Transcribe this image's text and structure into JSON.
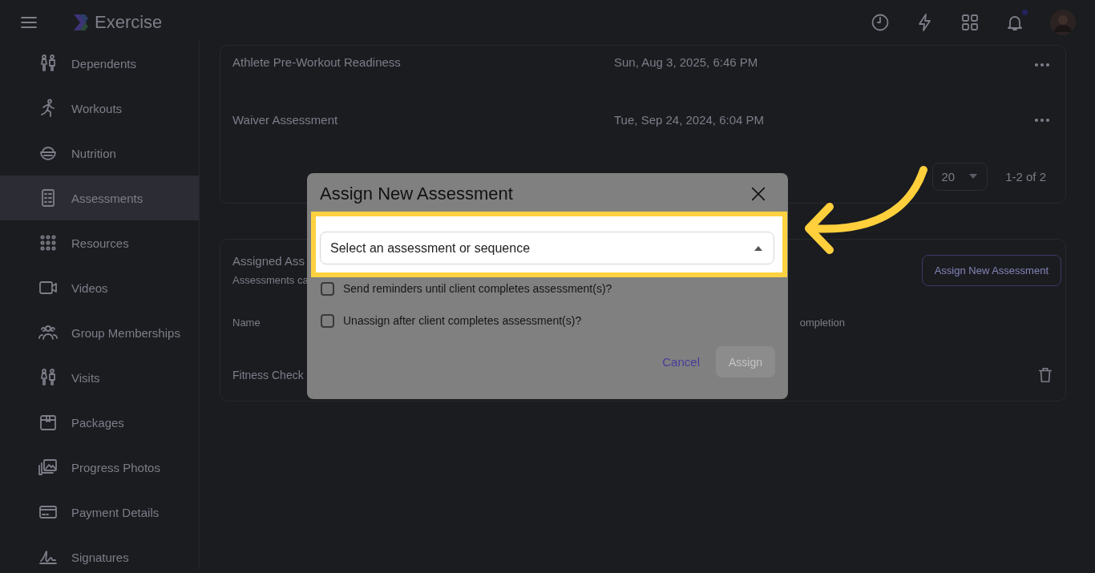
{
  "header": {
    "title": "Exercise",
    "has_notification": true
  },
  "sidebar": {
    "items": [
      {
        "label": "Dependents",
        "kind": "people",
        "selected": false
      },
      {
        "label": "Workouts",
        "kind": "runner",
        "selected": false
      },
      {
        "label": "Nutrition",
        "kind": "bowl",
        "selected": false
      },
      {
        "label": "Assessments",
        "kind": "checklist",
        "selected": true
      },
      {
        "label": "Resources",
        "kind": "dots",
        "selected": false
      },
      {
        "label": "Videos",
        "kind": "camera",
        "selected": false
      },
      {
        "label": "Group Memberships",
        "kind": "group",
        "selected": false
      },
      {
        "label": "Visits",
        "kind": "people",
        "selected": false
      },
      {
        "label": "Packages",
        "kind": "box",
        "selected": false
      },
      {
        "label": "Progress Photos",
        "kind": "photos",
        "selected": false
      },
      {
        "label": "Payment Details",
        "kind": "card",
        "selected": false
      },
      {
        "label": "Signatures",
        "kind": "signature",
        "selected": false
      }
    ]
  },
  "assessments_list": {
    "rows": [
      {
        "name": "Athlete Pre-Workout Readiness",
        "date": "Sun, Aug 3, 2025, 6:46 PM"
      },
      {
        "name": "Waiver Assessment",
        "date": "Tue, Sep 24, 2024, 6:04 PM"
      }
    ],
    "pagination": {
      "page_size": "20",
      "range": "1-2 of 2"
    }
  },
  "assigned": {
    "title": "Assigned Ass",
    "subtitle": "Assessments ca",
    "button": "Assign New Assessment",
    "columns": [
      "Name",
      "ompletion"
    ],
    "rows": [
      {
        "name": "Fitness Check"
      }
    ]
  },
  "dialog": {
    "title": "Assign New Assessment",
    "select": {
      "placeholder": "Select an assessment or sequence",
      "expanded": true
    },
    "options": [
      {
        "label": "Send reminders until client completes assessment(s)?",
        "checked": false
      },
      {
        "label": "Unassign after client completes assessment(s)?",
        "checked": false
      }
    ],
    "buttons": [
      {
        "label": "Cancel",
        "kind": "text",
        "disabled": false
      },
      {
        "label": "Assign",
        "kind": "filled",
        "disabled": true
      }
    ]
  }
}
